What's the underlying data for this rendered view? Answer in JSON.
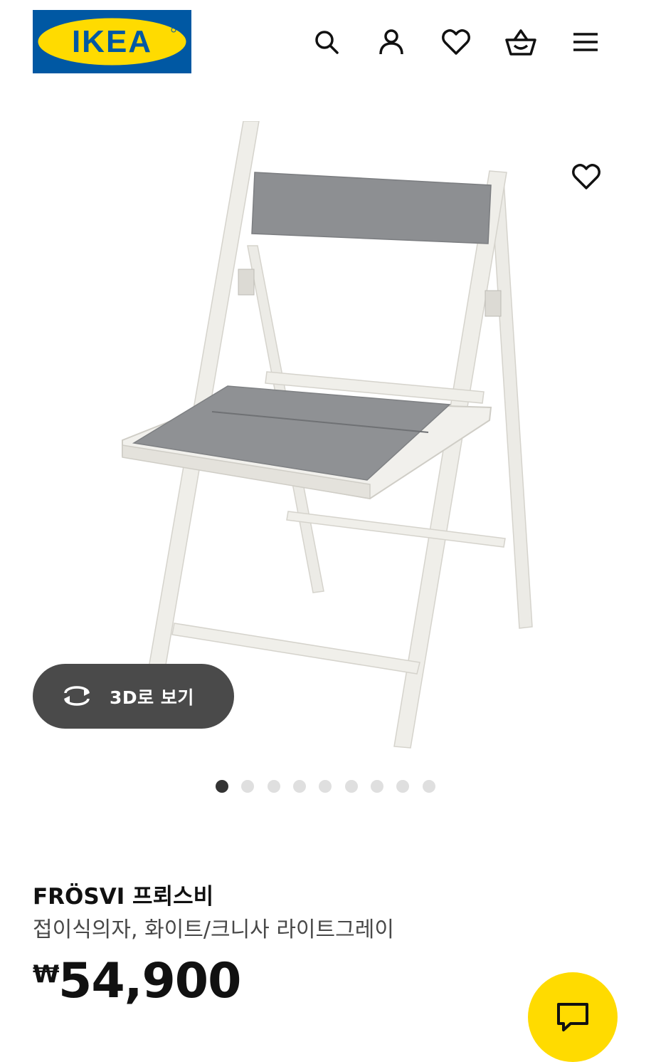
{
  "header": {
    "logo_text": "IKEA",
    "icons": [
      "search-icon",
      "account-icon",
      "favourites-icon",
      "basket-icon",
      "menu-icon"
    ]
  },
  "gallery": {
    "favourite_icon": "heart-icon",
    "view_3d_label": "3D로 보기",
    "view_3d_icon": "rotate-icon",
    "dot_count": 9,
    "active_dot": 1
  },
  "product": {
    "name": "FRÖSVI 프뢰스비",
    "description": "접이식의자, 화이트/크니사 라이트그레이",
    "currency_symbol": "₩",
    "price": "54,900"
  },
  "chat": {
    "icon": "chat-icon",
    "color": "#ffdb00"
  },
  "colors": {
    "brand_blue": "#0058a3",
    "brand_yellow": "#ffdb00",
    "pill_bg": "#4a4a4a"
  }
}
